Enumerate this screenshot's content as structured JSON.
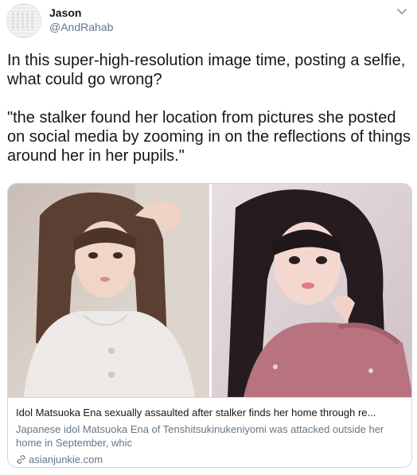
{
  "author": {
    "name": "Jason",
    "handle": "@AndRahab"
  },
  "tweet": {
    "text": "In this super-high-resolution image time, posting a selfie, what could go wrong?\n\n\"the stalker found her location from pictures she posted on social media by zooming in on the reflections of things around her in her pupils.\""
  },
  "card": {
    "title": "Idol Matsuoka Ena sexually assaulted after stalker finds her home through re...",
    "description": "Japanese idol Matsuoka Ena of Tenshitsukinukeniyomi was attacked outside her home in September, whic",
    "domain": "asianjunkie.com",
    "icons": {
      "link": "link-icon",
      "menu": "chevron-down-icon"
    }
  },
  "colors": {
    "text_primary": "#14171a",
    "text_secondary": "#657786",
    "border": "#ccd6dd"
  }
}
